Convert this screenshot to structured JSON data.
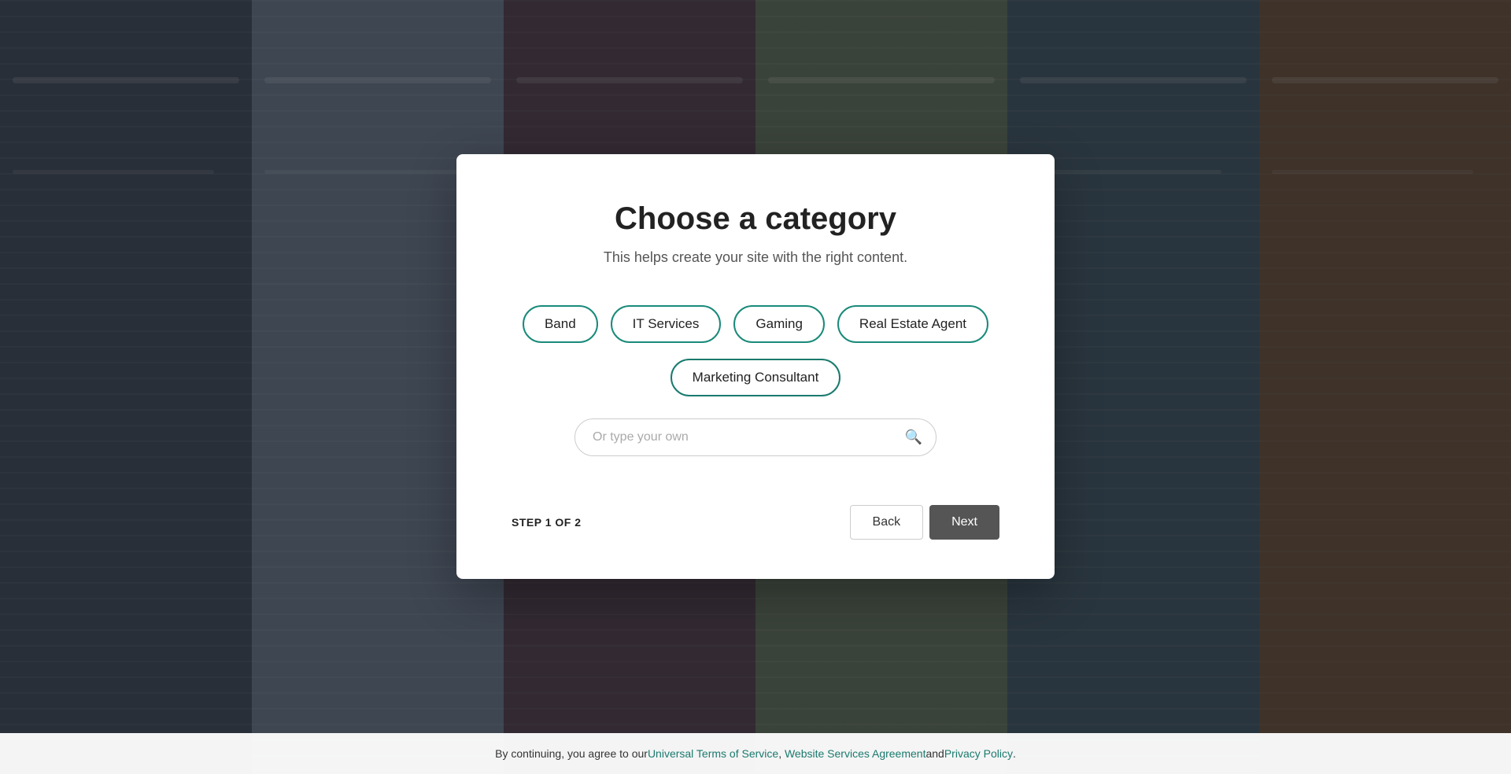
{
  "background": {
    "panels": 6
  },
  "modal": {
    "title": "Choose a category",
    "subtitle": "This helps create your site with the right content.",
    "chips": [
      {
        "id": "band",
        "label": "Band",
        "selected": false
      },
      {
        "id": "it-services",
        "label": "IT Services",
        "selected": false
      },
      {
        "id": "gaming",
        "label": "Gaming",
        "selected": false
      },
      {
        "id": "real-estate-agent",
        "label": "Real Estate Agent",
        "selected": false
      },
      {
        "id": "marketing-consultant",
        "label": "Marketing Consultant",
        "selected": true
      }
    ],
    "search_placeholder": "Or type your own",
    "search_value": ""
  },
  "footer_modal": {
    "step_label": "STEP 1 OF 2",
    "back_button": "Back",
    "next_button": "Next"
  },
  "footer_bar": {
    "text_before": "By continuing, you agree to our ",
    "tos_label": "Universal Terms of Service",
    "comma": ",",
    "wsa_label": "Website Services Agreement",
    "and_text": " and ",
    "pp_label": "Privacy Policy",
    "period": "."
  }
}
